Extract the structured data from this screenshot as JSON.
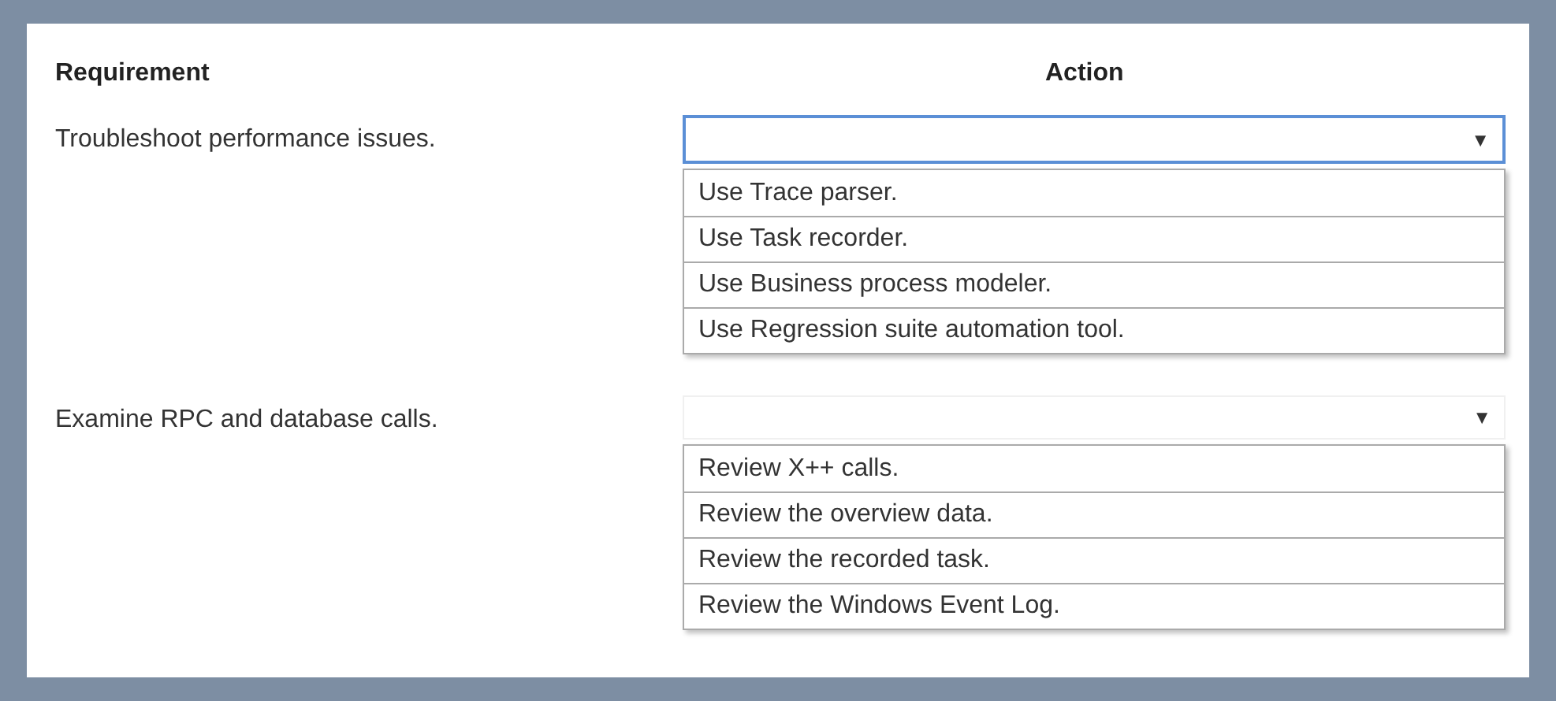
{
  "headers": {
    "requirement": "Requirement",
    "action": "Action"
  },
  "rows": [
    {
      "requirement": "Troubleshoot performance issues.",
      "dropdown": {
        "focused": true,
        "arrow": "▼",
        "options": [
          "Use Trace parser.",
          "Use Task recorder.",
          "Use Business process modeler.",
          "Use Regression suite automation tool."
        ]
      }
    },
    {
      "requirement": "Examine RPC and database calls.",
      "dropdown": {
        "focused": false,
        "arrow": "▼",
        "options": [
          "Review X++ calls.",
          "Review the overview data.",
          "Review the recorded task.",
          "Review the Windows Event Log."
        ]
      }
    }
  ]
}
